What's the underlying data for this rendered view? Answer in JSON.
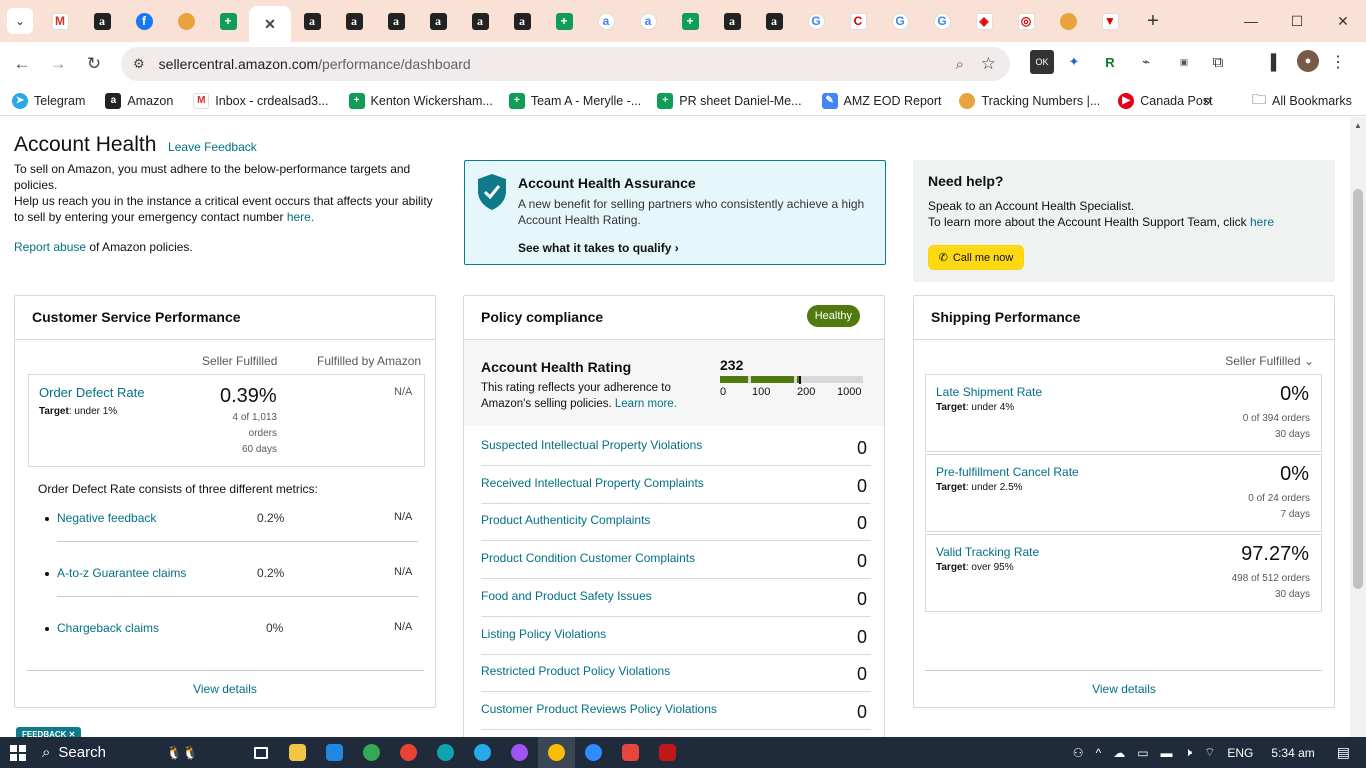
{
  "browser": {
    "url_host": "sellercentral.amazon.com",
    "url_path": "/performance/dashboard",
    "bookmarks": [
      {
        "label": "Telegram",
        "color": "#29a9eb"
      },
      {
        "label": "Amazon",
        "color": "#222222"
      },
      {
        "label": "Inbox - crdealsad3...",
        "color": "#d93025"
      },
      {
        "label": "Kenton Wickersham...",
        "color": "#0f9d58"
      },
      {
        "label": "Team A - Merylle -...",
        "color": "#0f9d58"
      },
      {
        "label": "PR sheet Daniel-Me...",
        "color": "#0f9d58"
      },
      {
        "label": "AMZ EOD Report",
        "color": "#4285f4"
      },
      {
        "label": "Tracking Numbers |...",
        "color": "#e8a33d"
      },
      {
        "label": "Canada Post",
        "color": "#e3001b"
      }
    ],
    "all_bookmarks": "All Bookmarks",
    "ext_badge": "OK"
  },
  "page": {
    "title": "Account Health",
    "leave_feedback": "Leave Feedback",
    "intro1": "To sell on Amazon, you must adhere to the below-performance targets and policies.",
    "intro2_a": "Help us reach you in the instance a critical event occurs that affects your ability to sell by entering your emergency contact number ",
    "intro2_link": "here.",
    "report_link": "Report abuse",
    "report_rest": " of Amazon policies.",
    "feedback_tab": "FEEDBACK ✕"
  },
  "assurance": {
    "title": "Account Health Assurance",
    "body": "A new benefit for selling partners who consistently achieve a high Account Health Rating.",
    "cta": "See what it takes to qualify"
  },
  "help": {
    "title": "Need help?",
    "line1": "Speak to an Account Health Specialist.",
    "line2": "To learn more about the Account Health Support Team, click ",
    "line2_link": "here",
    "button": "Call me now"
  },
  "customer_service": {
    "title": "Customer Service Performance",
    "col_seller": "Seller Fulfilled",
    "col_fba": "Fulfilled by Amazon",
    "odr_label": "Order Defect Rate",
    "odr_target_label": "Target",
    "odr_target": ": under 1%",
    "odr_value": "0.39%",
    "odr_orders_1": "4 of 1,013",
    "odr_orders_2": "orders",
    "odr_days": "60 days",
    "odr_fba": "N/A",
    "consists": "Order Defect Rate consists of three different metrics:",
    "metrics": [
      {
        "label": "Negative feedback",
        "seller": "0.2%",
        "fba": "N/A"
      },
      {
        "label": "A-to-z Guarantee claims",
        "seller": "0.2%",
        "fba": "N/A"
      },
      {
        "label": "Chargeback claims",
        "seller": "0%",
        "fba": "N/A"
      }
    ],
    "view_details": "View details"
  },
  "policy": {
    "title": "Policy compliance",
    "badge": "Healthy",
    "ahr_title": "Account Health Rating",
    "ahr_body": "This rating reflects your adherence to Amazon's selling policies.",
    "ahr_link": "Learn more.",
    "ahr_value": "232",
    "ahr_value_num": 232,
    "ahr_ticks": [
      "0",
      "100",
      "200",
      "1000"
    ],
    "items": [
      {
        "label": "Suspected Intellectual Property Violations",
        "value": "0"
      },
      {
        "label": "Received Intellectual Property Complaints",
        "value": "0"
      },
      {
        "label": "Product Authenticity Complaints",
        "value": "0"
      },
      {
        "label": "Product Condition Customer Complaints",
        "value": "0"
      },
      {
        "label": "Food and Product Safety Issues",
        "value": "0"
      },
      {
        "label": "Listing Policy Violations",
        "value": "0"
      },
      {
        "label": "Restricted Product Policy Violations",
        "value": "0"
      },
      {
        "label": "Customer Product Reviews Policy Violations",
        "value": "0"
      }
    ]
  },
  "shipping": {
    "title": "Shipping Performance",
    "filter": "Seller Fulfilled",
    "metrics": [
      {
        "label": "Late Shipment Rate",
        "target_label": "Target",
        "target": ": under 4%",
        "value": "0%",
        "orders": "0 of 394 orders",
        "days": "30 days"
      },
      {
        "label": "Pre-fulfillment Cancel Rate",
        "target_label": "Target",
        "target": ": under 2.5%",
        "value": "0%",
        "orders": "0 of 24 orders",
        "days": "7 days"
      },
      {
        "label": "Valid Tracking Rate",
        "target_label": "Target",
        "target": ": over 95%",
        "value": "97.27%",
        "orders": "498 of 512 orders",
        "days": "30 days"
      }
    ],
    "view_details": "View details"
  },
  "taskbar": {
    "search": "Search",
    "lang": "ENG",
    "time": "5:34 am"
  }
}
